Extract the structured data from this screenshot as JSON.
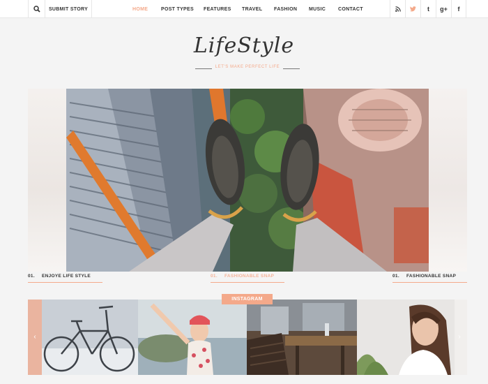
{
  "topbar": {
    "search_icon": "search-icon",
    "submit_label": "SUBMIT STORY",
    "nav": [
      {
        "label": "HOME",
        "active": true
      },
      {
        "label": "POST TYPES",
        "active": false
      },
      {
        "label": "FEATURES",
        "active": false
      },
      {
        "label": "TRAVEL",
        "active": false
      },
      {
        "label": "FASHION",
        "active": false
      },
      {
        "label": "MUSIC",
        "active": false
      },
      {
        "label": "CONTACT",
        "active": false
      }
    ],
    "social": [
      {
        "icon": "rss-icon",
        "glyph": "⌔"
      },
      {
        "icon": "twitter-icon",
        "glyph": "🐦"
      },
      {
        "icon": "tumblr-icon",
        "glyph": "t"
      },
      {
        "icon": "google-plus-icon",
        "glyph": "g+"
      },
      {
        "icon": "facebook-icon",
        "glyph": "f"
      }
    ]
  },
  "logo": {
    "text": "LifeStyle",
    "tagline": "LET'S MAKE PERFECT LIFE"
  },
  "slider": {
    "captions": [
      {
        "num": "01.",
        "title": "ENJOYE LIFE STYLE"
      },
      {
        "num": "01.",
        "title": "FASHIONABLE SNAP"
      },
      {
        "num": "01.",
        "title": "FASHIONABLE SNAP"
      }
    ]
  },
  "instagram": {
    "label": "INSTAGRAM",
    "prev_glyph": "‹",
    "next_glyph": "›"
  },
  "colors": {
    "accent": "#f4a98a",
    "background": "#f4f4f4",
    "text": "#333333"
  }
}
